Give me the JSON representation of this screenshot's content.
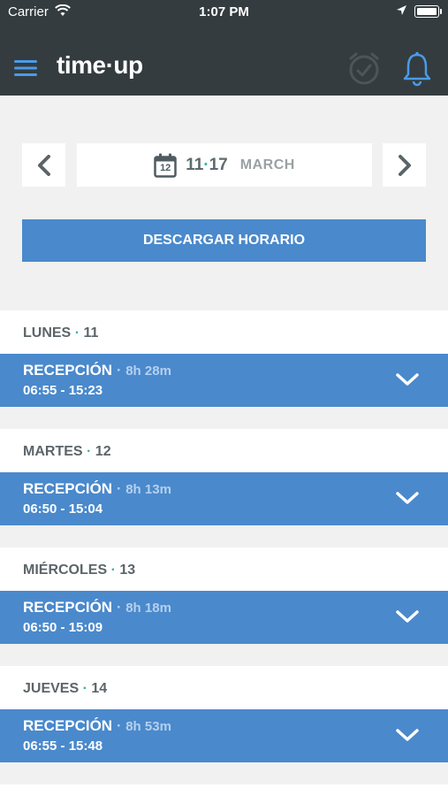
{
  "status_bar": {
    "carrier": "Carrier",
    "time": "1:07 PM"
  },
  "app": {
    "logo": "time·up"
  },
  "week_nav": {
    "range_start": "11",
    "range_end": "17",
    "month": "MARCH",
    "calendar_day": "12"
  },
  "download": {
    "label": "DESCARGAR HORARIO"
  },
  "days": [
    {
      "name": "LUNES",
      "num": "11",
      "shift": "RECEPCIÓN",
      "duration": "8h 28m",
      "hours": "06:55 - 15:23"
    },
    {
      "name": "MARTES",
      "num": "12",
      "shift": "RECEPCIÓN",
      "duration": "8h 13m",
      "hours": "06:50 - 15:04"
    },
    {
      "name": "MIÉRCOLES",
      "num": "13",
      "shift": "RECEPCIÓN",
      "duration": "8h 18m",
      "hours": "06:50 - 15:09"
    },
    {
      "name": "JUEVES",
      "num": "14",
      "shift": "RECEPCIÓN",
      "duration": "8h 53m",
      "hours": "06:55 - 15:48"
    }
  ],
  "colors": {
    "header": "#343c3f",
    "accent": "#4a89cc",
    "teal": "#38b59a",
    "background": "#f1f1f1"
  }
}
